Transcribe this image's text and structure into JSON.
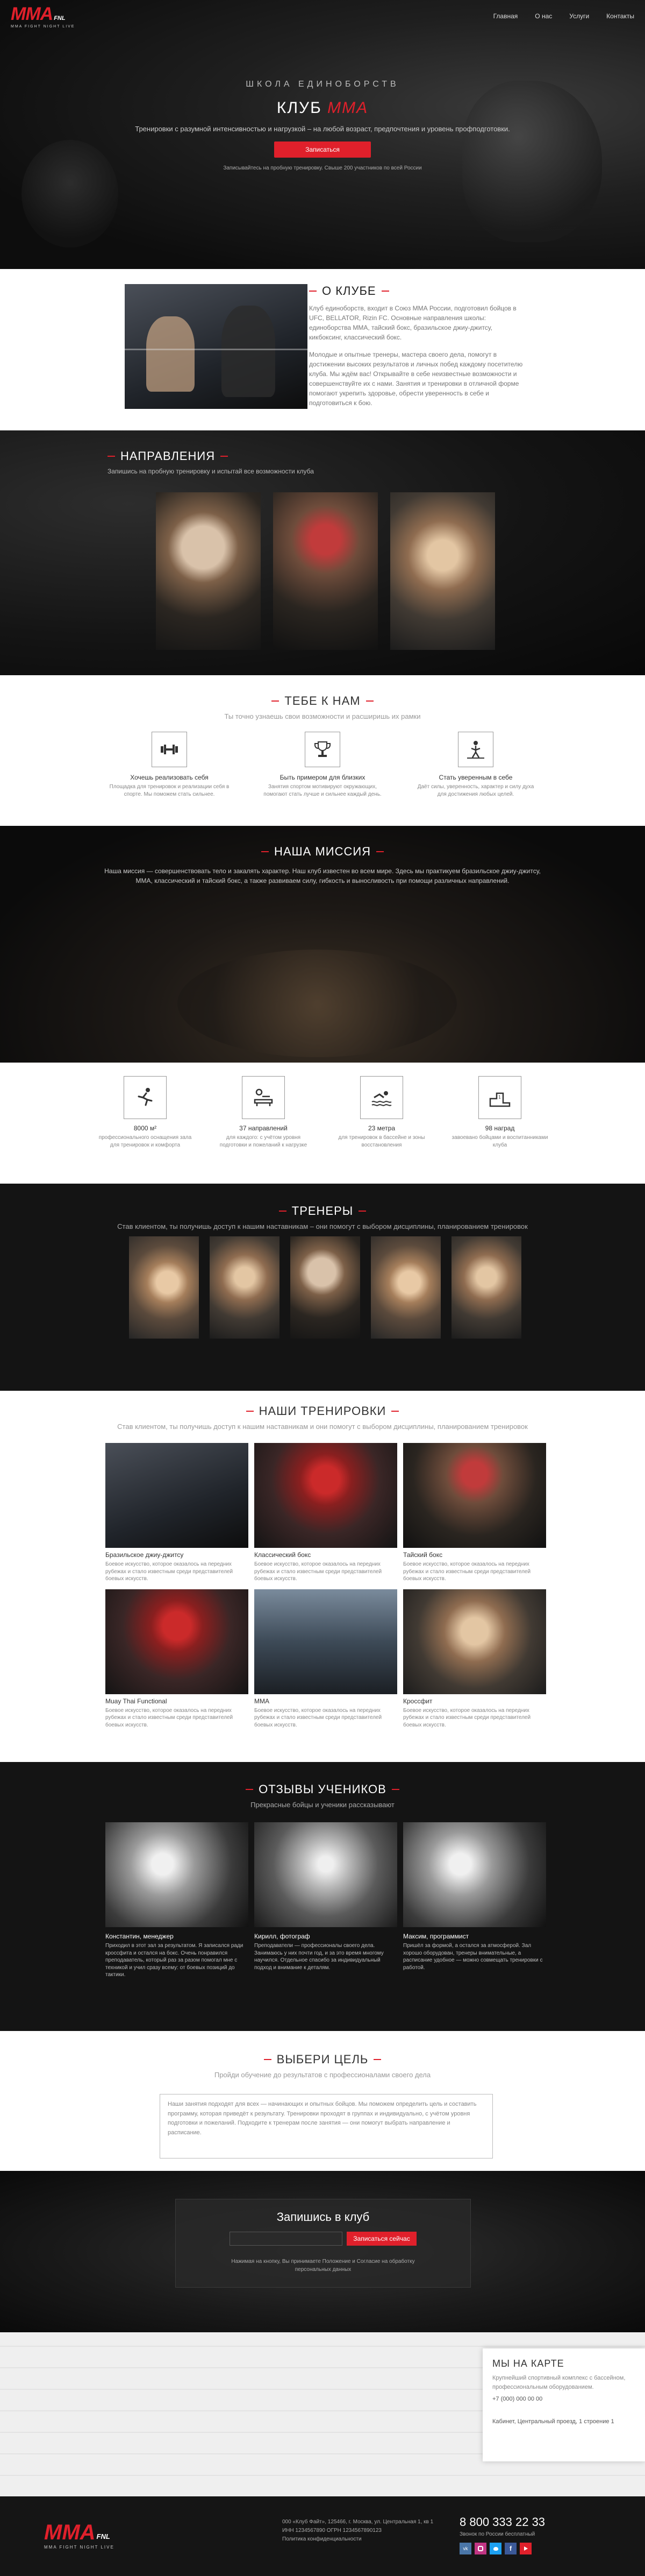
{
  "nav": {
    "logo_main": "MMA",
    "logo_tag": "FNL",
    "logo_sub": "MMA FIGHT NIGHT LIVE",
    "items": [
      "Главная",
      "О нас",
      "Услуги",
      "Контакты"
    ]
  },
  "hero": {
    "tagline": "ШКОЛА ЕДИНОБОРСТВ",
    "title_prefix": "КЛУБ",
    "title_accent": "MMA",
    "lead": "Тренировки с разумной интенсивностью и нагрузкой – на любой возраст, предпочтения и уровень профподготовки.",
    "button": "Записаться",
    "note": "Записывайтесь на пробную тренировку. Свыше 200 участников по всей России"
  },
  "about": {
    "title": "О КЛУБЕ",
    "p1": "Клуб единоборств, входит в Союз ММА России, подготовил бойцов в UFC, BELLATOR, Rizin FC. Основные направления школы: единоборства ММА, тайский бокс, бразильское джиу-джитсу, кикбоксинг, классический бокс.",
    "p2": "Молодые и опытные тренеры, мастера своего дела, помогут в достижении высоких результатов и личных побед каждому посетителю клуба. Мы ждём вас! Открывайте в себе неизвестные возможности и совершенствуйте их с нами. Занятия и тренировки в отличной форме помогают укрепить здоровье, обрести уверенность в себе и подготовиться к бою."
  },
  "directions": {
    "title": "НАПРАВЛЕНИЯ",
    "sub": "Запишись на пробную тренировку и испытай все возможности клуба"
  },
  "join": {
    "title": "ТЕБЕ К НАМ",
    "sub": "Ты точно узнаешь свои возможности и расширишь их рамки",
    "items": [
      {
        "icon": "dumbbell-icon",
        "title": "Хочешь реализовать себя",
        "text": "Площадка для тренировок и реализации себя в спорте. Мы поможем стать сильнее."
      },
      {
        "icon": "trophy-icon",
        "title": "Быть примером для близких",
        "text": "Занятия спортом мотивируют окружающих, помогают стать лучше и сильнее каждый день."
      },
      {
        "icon": "figure-icon",
        "title": "Стать уверенным в себе",
        "text": "Даёт силы, уверенность, характер и силу духа для достижения любых целей."
      }
    ]
  },
  "mission": {
    "title": "НАША МИССИЯ",
    "text": "Наша миссия — совершенствовать тело и закалять характер. Наш клуб известен во всем мире. Здесь мы практикуем бразильское джиу-джитсу, ММА, классический и тайский бокс, а также развиваем силу, гибкость и выносливость при помощи различных направлений."
  },
  "stats": [
    {
      "icon": "runner-icon",
      "value": "8000 м²",
      "text": "профессионального оснащения зала для тренировок и комфорта"
    },
    {
      "icon": "massage-icon",
      "value": "37 направлений",
      "text": "для каждого: с учётом уровня подготовки и пожеланий к нагрузке"
    },
    {
      "icon": "swimmer-icon",
      "value": "23 метра",
      "text": "для тренировок в бассейне и зоны восстановления"
    },
    {
      "icon": "podium-icon",
      "value": "98 наград",
      "text": "завоевано бойцами и воспитанниками клуба"
    }
  ],
  "trainers": {
    "title": "ТРЕНЕРЫ",
    "sub": "Став клиентом, ты получишь доступ к нашим наставникам – они помогут с выбором дисциплины, планированием тренировок"
  },
  "workouts": {
    "title": "НАШИ ТРЕНИРОВКИ",
    "sub": "Став клиентом, ты получишь доступ к нашим наставникам и они помогут с выбором дисциплины, планированием тренировок",
    "items": [
      {
        "title": "Бразильское джиу-джитсу",
        "text": "Боевое искусство, которое оказалось на передних рубежах и стало известным среди представителей боевых искусств."
      },
      {
        "title": "Классический бокс",
        "text": "Боевое искусство, которое оказалось на передних рубежах и стало известным среди представителей боевых искусств."
      },
      {
        "title": "Тайский бокс",
        "text": "Боевое искусство, которое оказалось на передних рубежах и стало известным среди представителей боевых искусств."
      },
      {
        "title": "Muay Thai Functional",
        "text": "Боевое искусство, которое оказалось на передних рубежах и стало известным среди представителей боевых искусств."
      },
      {
        "title": "MMA",
        "text": "Боевое искусство, которое оказалось на передних рубежах и стало известным среди представителей боевых искусств."
      },
      {
        "title": "Кроссфит",
        "text": "Боевое искусство, которое оказалось на передних рубежах и стало известным среди представителей боевых искусств."
      }
    ]
  },
  "reviews": {
    "title": "ОТЗЫВЫ УЧЕНИКОВ",
    "sub": "Прекрасные бойцы и ученики рассказывают",
    "items": [
      {
        "name": "Константин, менеджер",
        "text": "Приходил в этот зал за результатом. Я записался ради кроссфита и остался на бокс. Очень понравился преподаватель, который раз за разом помогал мне с техникой и учил сразу всему: от боевых позиций до тактики."
      },
      {
        "name": "Кирилл, фотограф",
        "text": "Преподаватели — профессионалы своего дела. Занимаюсь у них почти год, и за это время многому научился. Отдельное спасибо за индивидуальный подход и внимание к деталям."
      },
      {
        "name": "Максим, программист",
        "text": "Пришёл за формой, а остался за атмосферой. Зал хорошо оборудован, тренеры внимательные, а расписание удобное — можно совмещать тренировки с работой."
      }
    ]
  },
  "goal": {
    "title": "ВЫБЕРИ ЦЕЛЬ",
    "sub": "Пройди обучение до результатов с профессионалами своего дела",
    "text": "Наши занятия подходят для всех — начинающих и опытных бойцов. Мы поможем определить цель и составить программу, которая приведёт к результату. Тренировки проходят в группах и индивидуально, с учётом уровня подготовки и пожеланий. Подходите к тренерам после занятия — они помогут выбрать направление и расписание."
  },
  "signup": {
    "title": "Запишись в клуб",
    "input_placeholder": "",
    "button": "Записаться сейчас",
    "note": "Нажимая на кнопку, Вы принимаете Положение и Согласие на обработку персональных данных"
  },
  "map": {
    "title": "МЫ НА КАРТЕ",
    "text": "Крупнейший спортивный комплекс с бассейном, профессиональным оборудованием.",
    "phone": "+7 (000) 000 00 00",
    "address": "Кабинет, Центральный проезд, 1 строение 1"
  },
  "footer": {
    "address_lines": [
      "000 «Клуб Файт», 125466, г. Москва, ул. Центральная 1, кв 1",
      "ИНН 1234567890 ОГРН 1234567890123",
      "Политика конфиденциальности"
    ],
    "phone": "8 800 333 22 33",
    "phone_note": "Звонок по России бесплатный",
    "socials": [
      "vk-icon",
      "instagram-icon",
      "twitter-icon",
      "facebook-icon",
      "youtube-icon"
    ]
  }
}
